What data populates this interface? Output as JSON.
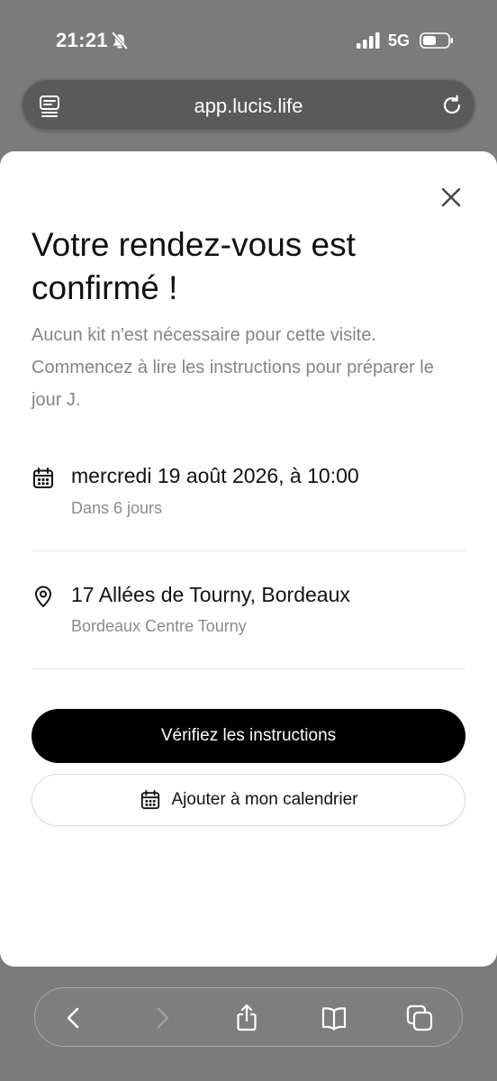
{
  "status_bar": {
    "time": "21:21",
    "network": "5G",
    "icons": [
      "bell-slash-icon",
      "signal-icon",
      "battery-icon"
    ]
  },
  "browser": {
    "url": "app.lucis.life",
    "icons": [
      "reader-icon",
      "reload-icon"
    ]
  },
  "modal": {
    "title": "Votre rendez-vous est confirmé !",
    "subtitle": "Aucun kit n'est nécessaire pour cette visite. Commencez à lire les instructions pour préparer le jour J.",
    "appointment": {
      "date": "mercredi 19 août 2026, à 10:00",
      "relative": "Dans 6 jours",
      "icon": "calendar-icon"
    },
    "location": {
      "address": "17 Allées de Tourny, Bordeaux",
      "center": "Bordeaux Centre Tourny",
      "icon": "location-pin-icon"
    },
    "primary_button": "Vérifiez les instructions",
    "secondary_button": "Ajouter à mon calendrier"
  },
  "toolbar": {
    "icons": [
      "back-icon",
      "forward-icon",
      "share-icon",
      "bookmarks-icon",
      "tabs-icon"
    ]
  },
  "colors": {
    "backdrop": "#7b7b7b",
    "sheet": "#ffffff",
    "primary_button": "#000000",
    "muted_text": "#858585"
  }
}
